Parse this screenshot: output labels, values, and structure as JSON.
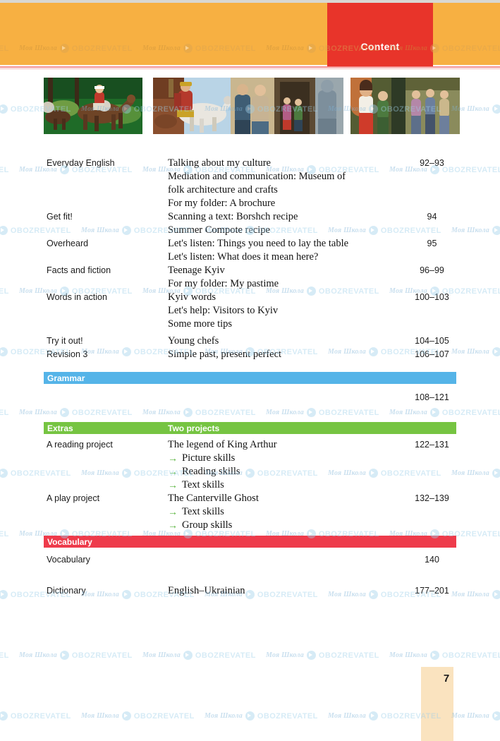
{
  "header": {
    "tab_label": "Content",
    "band_color": "#f7b042",
    "tab_color": "#e8342a"
  },
  "thumbnails": [
    {
      "name": "horse-riders-forest-thumbnail"
    },
    {
      "name": "knight-on-white-horse-thumbnail"
    },
    {
      "name": "people-at-castle-entrance-thumbnail"
    },
    {
      "name": "indoor-group-scene-thumbnail"
    }
  ],
  "toc": {
    "rows": [
      {
        "left": "Everyday English",
        "lines": [
          {
            "text": "Talking about my culture"
          },
          {
            "text": "Mediation and communication: Museum of"
          },
          {
            "text": "folk architecture and crafts"
          },
          {
            "text": "For my folder: A brochure"
          }
        ],
        "pages": "92–93"
      },
      {
        "left": "Get fit!",
        "lines": [
          {
            "text": "Scanning a text: Borshch recipe"
          },
          {
            "text": "Summer Compote recipe"
          }
        ],
        "pages": "94"
      },
      {
        "left": "Overheard",
        "lines": [
          {
            "text": "Let's listen: Things you need to lay the table"
          },
          {
            "text": "Let's listen: What does it mean here?"
          }
        ],
        "pages": "95"
      },
      {
        "left": "Facts and fiction",
        "lines": [
          {
            "text": "Teenage Kyiv"
          },
          {
            "text": "For my folder: My pastime"
          }
        ],
        "pages": "96–99"
      },
      {
        "left": "Words in action",
        "lines": [
          {
            "text": "Kyiv words"
          },
          {
            "text": "Let's help: Visitors to Kyiv"
          },
          {
            "text": "Some more tips"
          }
        ],
        "pages": "100–103"
      },
      {
        "left": "Try it out!",
        "lines": [
          {
            "text": "Young chefs"
          }
        ],
        "pages": "104–105"
      },
      {
        "left": "Revision 3",
        "lines": [
          {
            "text": "Simple past, present perfect"
          }
        ],
        "pages": "106–107"
      }
    ],
    "grammar_bar": {
      "label": "Grammar",
      "color": "#55b4e8",
      "pages": "108–121"
    },
    "extras_bar": {
      "label_left": "Extras",
      "label_mid": "Two projects",
      "color": "#76c442"
    },
    "project_rows": [
      {
        "left": "A reading project",
        "lines": [
          {
            "text": "The legend of King Arthur",
            "arrow": false
          },
          {
            "text": "Picture skills",
            "arrow": true
          },
          {
            "text": "Reading skills",
            "arrow": true
          },
          {
            "text": "Text skills",
            "arrow": true
          }
        ],
        "pages": "122–131"
      },
      {
        "left": "A play project",
        "lines": [
          {
            "text": "The Canterville Ghost",
            "arrow": false
          },
          {
            "text": "Text skills",
            "arrow": true
          },
          {
            "text": "Group skills",
            "arrow": true
          }
        ],
        "pages": "132–139"
      }
    ],
    "vocabulary_bar": {
      "label": "Vocabulary",
      "color": "#ee3b4b"
    },
    "vocab_rows": [
      {
        "left": "Vocabulary",
        "lines": [],
        "pages": "140"
      },
      {
        "left": "Dictionary",
        "lines": [
          {
            "text": "English–Ukrainian"
          }
        ],
        "pages": "177–201"
      }
    ]
  },
  "footer": {
    "page_number": "7"
  },
  "watermark": {
    "school_text": "Моя Школа",
    "brand_text": "OBOZREVATEL",
    "icon": "play-circle-icon"
  },
  "arrow_glyph": "→"
}
